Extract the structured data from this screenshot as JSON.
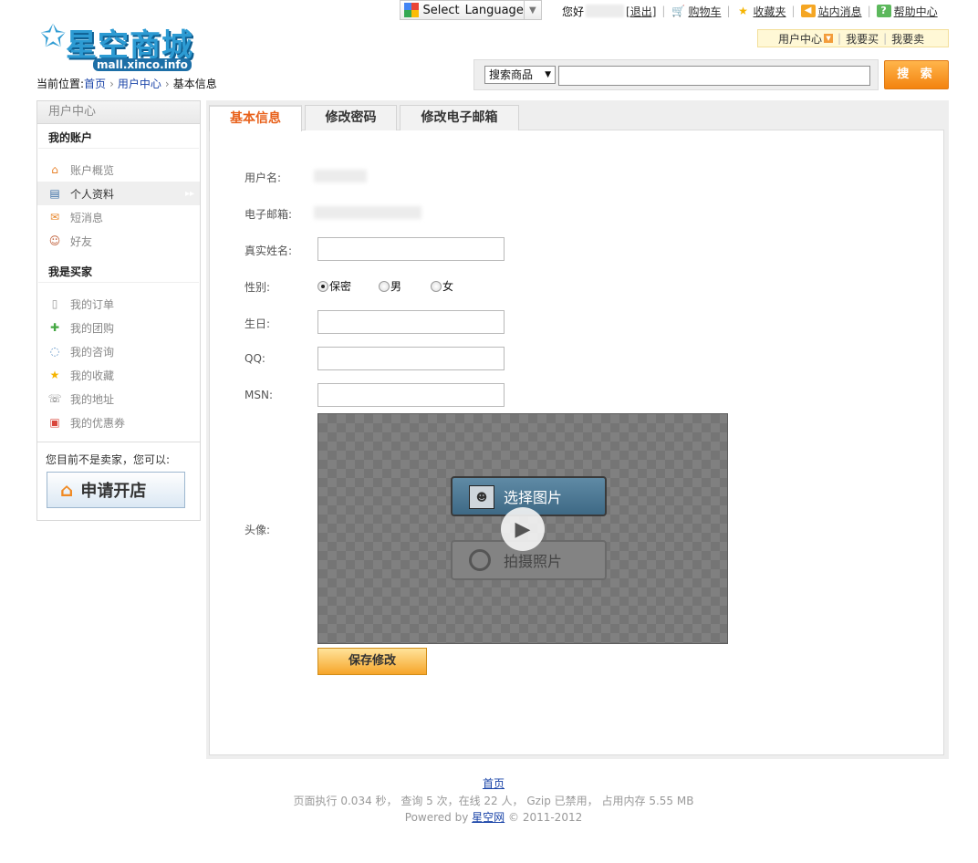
{
  "header": {
    "language_select": {
      "label": "Select",
      "value": "Language"
    },
    "greeting": "您好",
    "logout": "[退出]",
    "links": [
      {
        "label": "购物车",
        "icon": "cart-icon"
      },
      {
        "label": "收藏夹",
        "icon": "star-icon"
      },
      {
        "label": "站内消息",
        "icon": "speaker-icon"
      },
      {
        "label": "帮助中心",
        "icon": "help-icon"
      }
    ],
    "mini_nav": [
      "用户中心",
      "我要买",
      "我要卖"
    ],
    "logo_text": "星空商城",
    "logo_sub": "mall.xinco.info",
    "breadcrumb": {
      "prefix": "当前位置:",
      "items": [
        "首页",
        "用户中心"
      ],
      "current": "基本信息"
    },
    "search": {
      "category": "搜索商品",
      "query": "",
      "button": "搜 索"
    }
  },
  "sidebar": {
    "title": "用户中心",
    "groups": [
      {
        "title": "我的账户",
        "items": [
          {
            "label": "账户概览",
            "icon": "house-icon",
            "active": false
          },
          {
            "label": "个人资料",
            "icon": "id-card-icon",
            "active": true
          },
          {
            "label": "短消息",
            "icon": "envelope-icon",
            "active": false
          },
          {
            "label": "好友",
            "icon": "friends-icon",
            "active": false
          }
        ]
      },
      {
        "title": "我是买家",
        "items": [
          {
            "label": "我的订单",
            "icon": "document-icon",
            "active": false
          },
          {
            "label": "我的团购",
            "icon": "puzzle-icon",
            "active": false
          },
          {
            "label": "我的咨询",
            "icon": "chat-bubble-icon",
            "active": false
          },
          {
            "label": "我的收藏",
            "icon": "star-icon",
            "active": false
          },
          {
            "label": "我的地址",
            "icon": "address-book-icon",
            "active": false
          },
          {
            "label": "我的优惠券",
            "icon": "coupon-icon",
            "active": false
          }
        ]
      }
    ],
    "seller_note": "您目前不是卖家，您可以:",
    "open_shop": "申请开店"
  },
  "tabs": [
    {
      "label": "基本信息",
      "active": true
    },
    {
      "label": "修改密码",
      "active": false
    },
    {
      "label": "修改电子邮箱",
      "active": false
    }
  ],
  "form": {
    "username_label": "用户名:",
    "email_label": "电子邮箱:",
    "realname_label": "真实姓名:",
    "realname_value": "",
    "gender_label": "性别:",
    "gender_options": [
      "保密",
      "男",
      "女"
    ],
    "gender_selected": "保密",
    "birthday_label": "生日:",
    "birthday_value": "",
    "qq_label": "QQ:",
    "qq_value": "",
    "msn_label": "MSN:",
    "msn_value": "",
    "avatar_label": "头像:",
    "avatar_pick": "选择图片",
    "avatar_shoot": "拍摄照片",
    "save": "保存修改"
  },
  "footer": {
    "home": "首页",
    "stats": "页面执行 0.034 秒， 查询 5 次，在线 22 人， Gzip 已禁用， 占用内存 5.55 MB",
    "powered_prefix": "Powered by",
    "powered_link": "星空网",
    "copyright": "© 2011-2012"
  },
  "colors": {
    "accent_orange": "#f3830f",
    "tab_active_text": "#e8611b",
    "link_blue": "#1a44a8"
  }
}
